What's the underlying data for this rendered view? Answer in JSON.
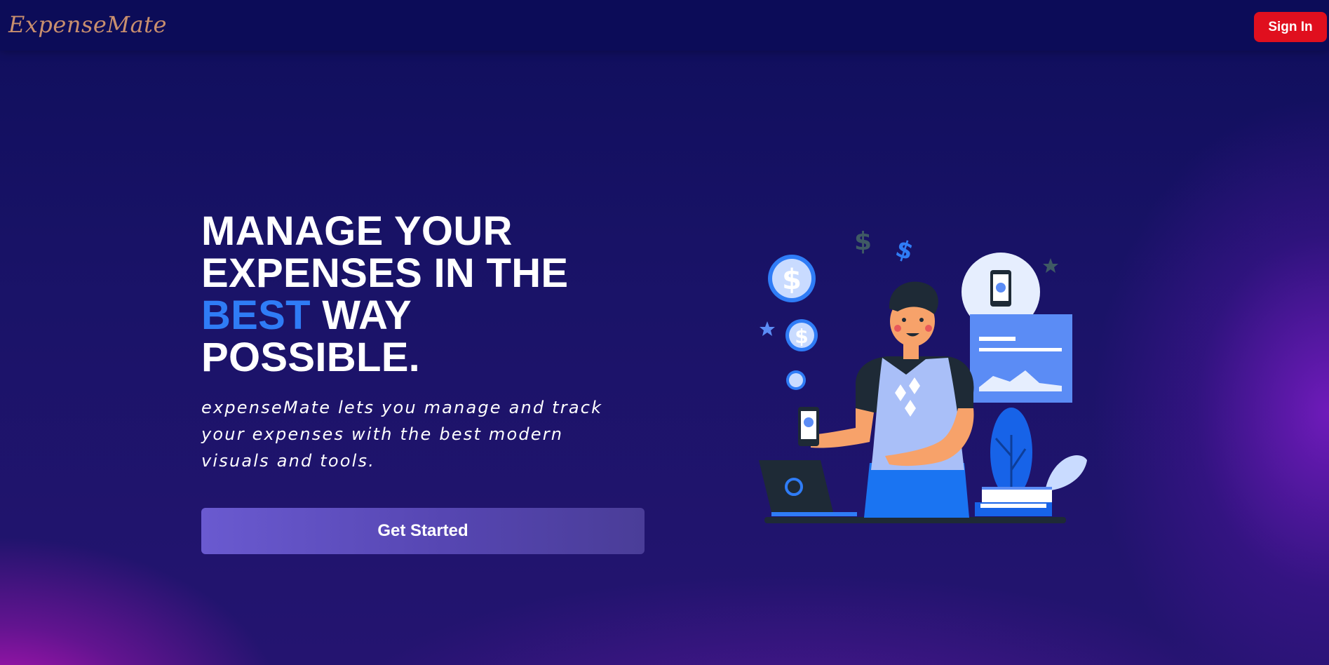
{
  "header": {
    "logo_text": "ExpenseMate",
    "signin_label": "Sign In"
  },
  "hero": {
    "headline_line1": "MANAGE YOUR",
    "headline_line2": "EXPENSES IN THE",
    "headline_accent": "BEST",
    "headline_line3_rest": " WAY",
    "headline_line4": "POSSIBLE.",
    "subtitle": "expenseMate lets you manage and track your expenses with the best modern visuals and tools.",
    "cta_label": "Get Started"
  },
  "illustration": {
    "coin_symbol": "$"
  },
  "colors": {
    "header_bg": "#0c0c58",
    "signin_bg": "#e00f1e",
    "accent": "#2f7cf6",
    "cta_start": "#6a5ad0",
    "cta_end": "#4a3d98",
    "logo": "#c98f6e"
  }
}
